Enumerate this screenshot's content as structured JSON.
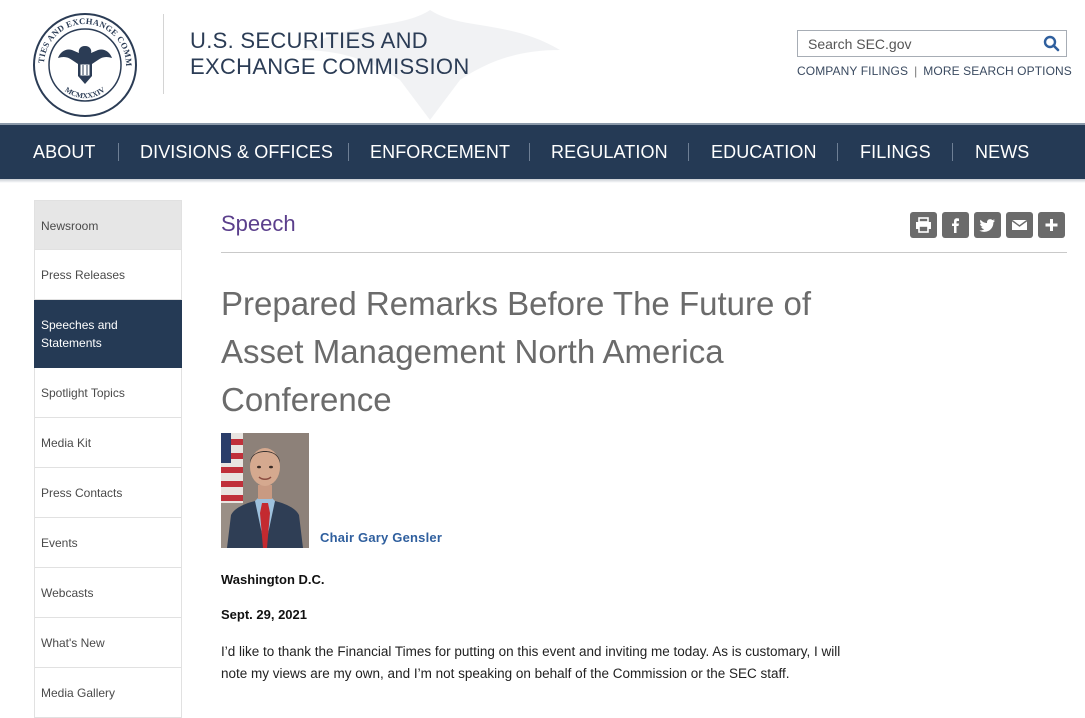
{
  "header": {
    "seal_text": "SECURITIES AND EXCHANGE COMMISSION",
    "seal_year": "MCMXXXIV",
    "agency_line1": "U.S. SECURITIES AND",
    "agency_line2": "EXCHANGE COMMISSION",
    "search_placeholder": "Search SEC.gov",
    "company_filings": "COMPANY FILINGS",
    "separator": "|",
    "more_search": "MORE SEARCH OPTIONS"
  },
  "nav": {
    "items": [
      "ABOUT",
      "DIVISIONS & OFFICES",
      "ENFORCEMENT",
      "REGULATION",
      "EDUCATION",
      "FILINGS",
      "NEWS"
    ]
  },
  "sidebar": {
    "items": [
      {
        "label": "Newsroom"
      },
      {
        "label": "Press Releases"
      },
      {
        "label": "Speeches and Statements"
      },
      {
        "label": "Spotlight Topics"
      },
      {
        "label": "Media Kit"
      },
      {
        "label": "Press Contacts"
      },
      {
        "label": "Events"
      },
      {
        "label": "Webcasts"
      },
      {
        "label": "What's New"
      },
      {
        "label": "Media Gallery"
      }
    ],
    "active_index": 2
  },
  "main": {
    "section_label": "Speech",
    "share_icons": [
      "print-icon",
      "facebook-icon",
      "twitter-icon",
      "email-icon",
      "plus-icon"
    ],
    "title": "Prepared Remarks Before The Future of Asset Management North America Conference",
    "author": "Chair Gary Gensler",
    "location": "Washington D.C.",
    "date": "Sept. 29, 2021",
    "paragraph": "I’d like to thank the Financial Times for putting on this event and inviting me today. As is customary, I will note my views are my own, and I’m not speaking on behalf of the Commission or the SEC staff."
  },
  "colors": {
    "nav_bg": "#253a55",
    "speech_purple": "#5b3f8c",
    "author_blue": "#2f5f9e",
    "share_gray": "#6b6b6b"
  }
}
